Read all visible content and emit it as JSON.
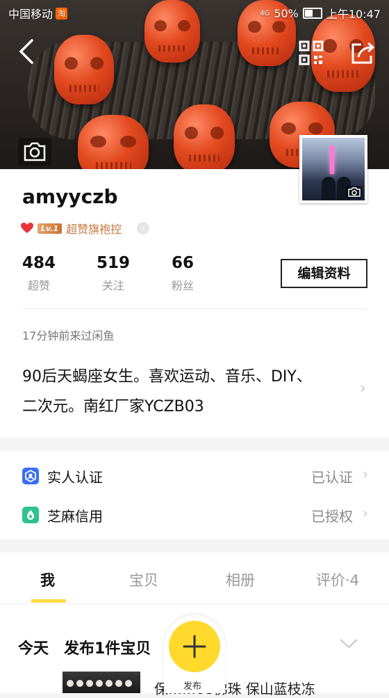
{
  "status_bar": {
    "carrier": "中国移动",
    "app_badge": "淘",
    "network": "4G",
    "battery": "50%",
    "time": "上午10:47"
  },
  "profile": {
    "username": "amyyczb",
    "level_badge": "Lv.1",
    "level_title": "超赞旗袍控",
    "stats": [
      {
        "value": "484",
        "label": "超赞"
      },
      {
        "value": "519",
        "label": "关注"
      },
      {
        "value": "66",
        "label": "粉丝"
      }
    ],
    "edit_label": "编辑资料",
    "last_seen": "17分钟前来过闲鱼",
    "bio_line1": "90后天蝎座女生。喜欢运动、音乐、DIY、",
    "bio_line2": "二次元。南红厂家YCZB03"
  },
  "verification": [
    {
      "title": "实人认证",
      "status": "已认证",
      "icon": "id-verify-icon",
      "color": "#3b6ef2"
    },
    {
      "title": "芝麻信用",
      "status": "已授权",
      "icon": "sesame-credit-icon",
      "color": "#2fc28d"
    }
  ],
  "tabs": [
    {
      "label": "我",
      "active": true
    },
    {
      "label": "宝贝",
      "active": false
    },
    {
      "label": "相册",
      "active": false
    },
    {
      "label": "评价·4",
      "active": false
    }
  ],
  "feed": {
    "day": "今天",
    "summary": "发布1件宝贝",
    "item_title": "保……08佛珠 保山蓝枝冻"
  },
  "fab": {
    "label": "发布"
  },
  "colors": {
    "accent": "#ffda2c",
    "level": "#c8763b"
  }
}
